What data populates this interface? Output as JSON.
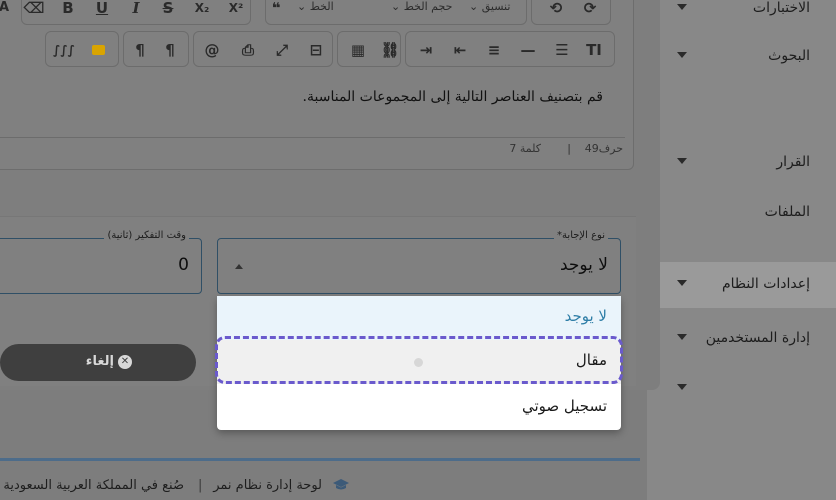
{
  "sidebar": {
    "items": [
      {
        "label": "الاختبارات"
      },
      {
        "label": "البحوث"
      },
      {
        "label": "القرار"
      },
      {
        "label": "الملفات"
      },
      {
        "label": "إعدادات النظام"
      },
      {
        "label": "إدارة المستخدمين"
      },
      {
        "label": ""
      }
    ]
  },
  "toolbar": {
    "font_label": "الخط",
    "size_label": "حجم الخط",
    "format_label": "تنسيق"
  },
  "editor": {
    "content": "قم بتصنيف العناصر التالية إلى المجموعات المناسبة.",
    "char_count": "حرف49",
    "word_count": "كلمة 7",
    "separator": "|"
  },
  "answer_type": {
    "label": "نوع الإجابة*",
    "value": "لا يوجد",
    "options": [
      "لا يوجد",
      "مقال",
      "تسجيل صوتي"
    ]
  },
  "think_time": {
    "label": "وقت التفكير (ثانية)",
    "value": "0"
  },
  "cancel_button": {
    "label": "إلغاء"
  },
  "footer": {
    "brand": "لوحة إدارة نظام نمر",
    "made_in": "صُنع في المملكة العربية السعودية"
  }
}
